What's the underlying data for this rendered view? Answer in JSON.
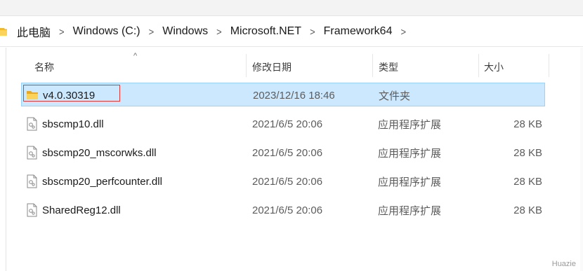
{
  "address_bar": {
    "crumbs": [
      "此电脑",
      "Windows (C:)",
      "Windows",
      "Microsoft.NET",
      "Framework64"
    ],
    "separator": ">"
  },
  "columns": {
    "name": "名称",
    "date": "修改日期",
    "type": "类型",
    "size": "大小",
    "sort_indicator": "^"
  },
  "rows": [
    {
      "name": "v4.0.30319",
      "date": "2023/12/16 18:46",
      "type": "文件夹",
      "size": "",
      "icon": "folder-icon",
      "selected": true
    },
    {
      "name": "sbscmp10.dll",
      "date": "2021/6/5 20:06",
      "type": "应用程序扩展",
      "size": "28 KB",
      "icon": "dll-file-icon",
      "selected": false
    },
    {
      "name": "sbscmp20_mscorwks.dll",
      "date": "2021/6/5 20:06",
      "type": "应用程序扩展",
      "size": "28 KB",
      "icon": "dll-file-icon",
      "selected": false
    },
    {
      "name": "sbscmp20_perfcounter.dll",
      "date": "2021/6/5 20:06",
      "type": "应用程序扩展",
      "size": "28 KB",
      "icon": "dll-file-icon",
      "selected": false
    },
    {
      "name": "SharedReg12.dll",
      "date": "2021/6/5 20:06",
      "type": "应用程序扩展",
      "size": "28 KB",
      "icon": "dll-file-icon",
      "selected": false
    }
  ],
  "watermark": "Huazie",
  "colors": {
    "selection_bg": "#cce8ff",
    "selection_border": "#99d1ff",
    "highlight_box": "#e03a3a",
    "folder": "#f7c948"
  }
}
